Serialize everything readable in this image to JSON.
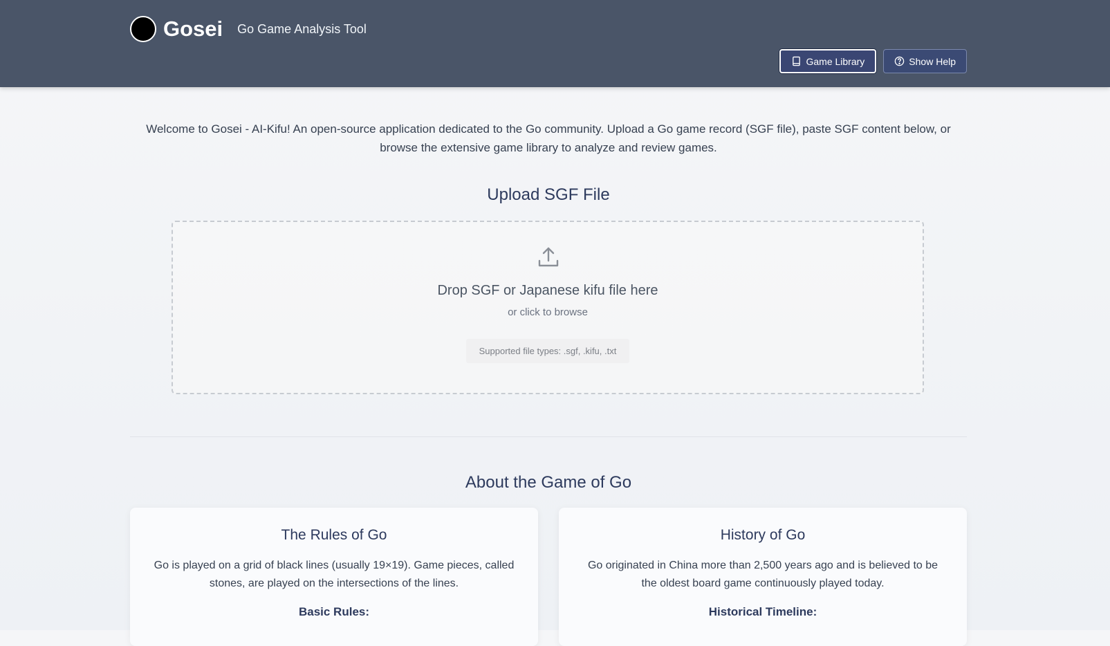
{
  "header": {
    "app_name": "Gosei",
    "tagline": "Go Game Analysis Tool",
    "buttons": {
      "game_library": {
        "label": "Game Library",
        "icon": "book-icon"
      },
      "show_help": {
        "label": "Show Help",
        "icon": "question-circle-icon"
      }
    },
    "colors": {
      "bar": "#4a5568",
      "button": "#3b4a74"
    }
  },
  "intro": {
    "text": "Welcome to Gosei - AI-Kifu! An open-source application dedicated to the Go community. Upload a Go game record (SGF file), paste SGF content below, or browse the extensive game library to analyze and review games."
  },
  "upload": {
    "title": "Upload SGF File",
    "icon": "upload-icon",
    "heading": "Drop SGF or Japanese kifu file here",
    "subtext": "or click to browse",
    "file_types": "Supported file types: .sgf, .kifu, .txt"
  },
  "about": {
    "title": "About the Game of Go",
    "cards": [
      {
        "title": "The Rules of Go",
        "text": "Go is played on a grid of black lines (usually 19×19). Game pieces, called stones, are played on the intersections of the lines.",
        "subhead": "Basic Rules:"
      },
      {
        "title": "History of Go",
        "text": "Go originated in China more than 2,500 years ago and is believed to be the oldest board game continuously played today.",
        "subhead": "Historical Timeline:"
      }
    ]
  }
}
